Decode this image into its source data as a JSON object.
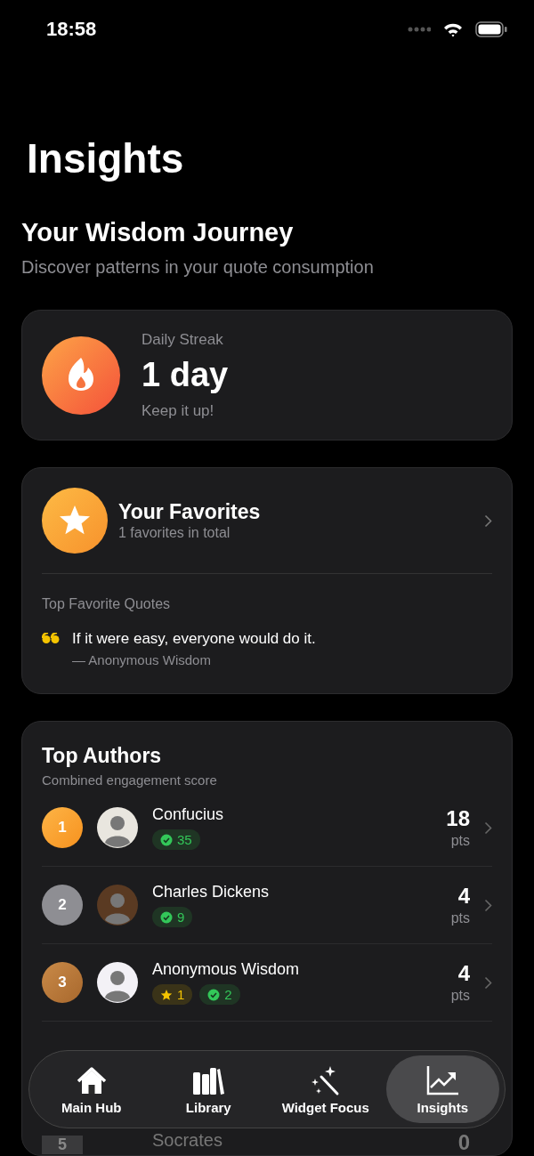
{
  "status_bar": {
    "time": "18:58"
  },
  "title": "Insights",
  "header": {
    "title": "Your Wisdom Journey",
    "subtitle": "Discover patterns in your quote consumption"
  },
  "streak": {
    "label": "Daily Streak",
    "value": "1 day",
    "note": "Keep it up!"
  },
  "favorites": {
    "title": "Your Favorites",
    "subtitle": "1 favorites in total",
    "section": "Top Favorite Quotes",
    "quotes": [
      {
        "text": "If it were easy, everyone would do it.",
        "author": "— Anonymous Wisdom"
      }
    ]
  },
  "authors": {
    "title": "Top Authors",
    "subtitle": "Combined engagement score",
    "rows": [
      {
        "rank": "1",
        "kind": "gold",
        "name": "Confucius",
        "score": "18",
        "unit": "pts",
        "badges": [
          {
            "kind": "read",
            "count": "35"
          }
        ]
      },
      {
        "rank": "2",
        "kind": "silver",
        "name": "Charles Dickens",
        "score": "4",
        "unit": "pts",
        "badges": [
          {
            "kind": "read",
            "count": "9"
          }
        ]
      },
      {
        "rank": "3",
        "kind": "bronze",
        "name": "Anonymous Wisdom",
        "score": "4",
        "unit": "pts",
        "badges": [
          {
            "kind": "star",
            "count": "1"
          },
          {
            "kind": "read",
            "count": "2"
          }
        ]
      },
      {
        "rank": "5",
        "kind": "plain",
        "name": "Socrates",
        "score": "0"
      }
    ]
  },
  "tabs": [
    {
      "label": "Main Hub",
      "selected": false
    },
    {
      "label": "Library",
      "selected": false
    },
    {
      "label": "Widget Focus",
      "selected": false
    },
    {
      "label": "Insights",
      "selected": true
    }
  ]
}
